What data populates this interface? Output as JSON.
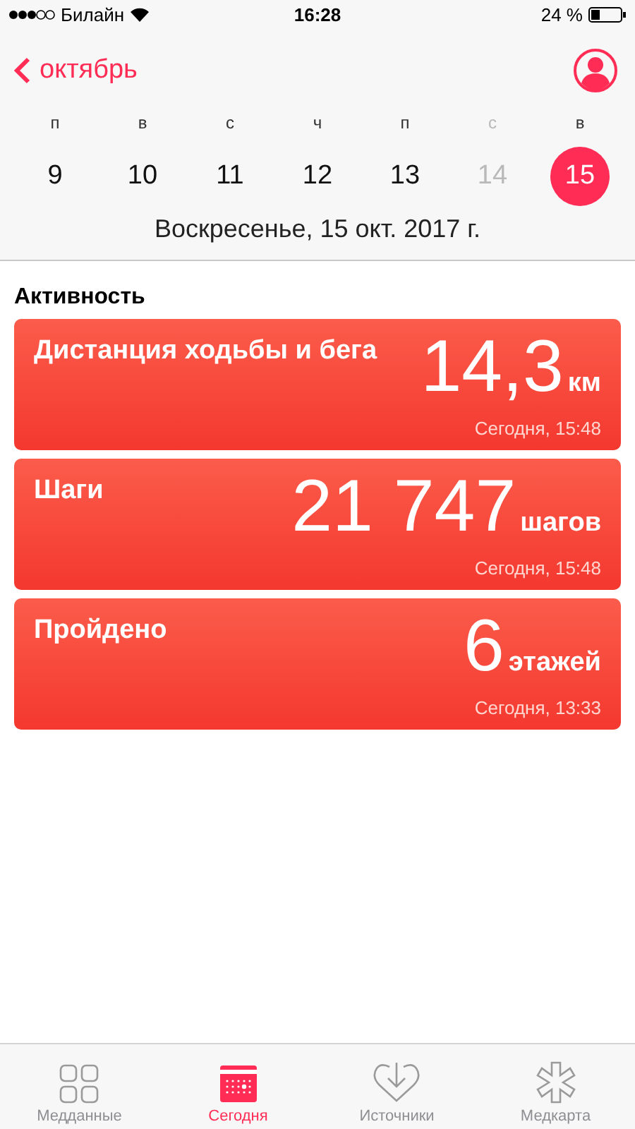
{
  "status_bar": {
    "carrier": "Билайн",
    "time": "16:28",
    "battery": "24 %"
  },
  "nav": {
    "back": "октябрь"
  },
  "week": [
    {
      "weekday": "п",
      "day": "9",
      "selected": false,
      "dimmed": false
    },
    {
      "weekday": "в",
      "day": "10",
      "selected": false,
      "dimmed": false
    },
    {
      "weekday": "с",
      "day": "11",
      "selected": false,
      "dimmed": false
    },
    {
      "weekday": "ч",
      "day": "12",
      "selected": false,
      "dimmed": false
    },
    {
      "weekday": "п",
      "day": "13",
      "selected": false,
      "dimmed": false
    },
    {
      "weekday": "с",
      "day": "14",
      "selected": false,
      "dimmed": true
    },
    {
      "weekday": "в",
      "day": "15",
      "selected": true,
      "dimmed": false
    }
  ],
  "date_title": "Воскресенье, 15 окт. 2017 г.",
  "section_title": "Активность",
  "cards": [
    {
      "title": "Дистанция ходьбы и бега",
      "value": "14,3",
      "unit": "км",
      "time": "Сегодня, 15:48"
    },
    {
      "title": "Шаги",
      "value": "21 747",
      "unit": "шагов",
      "time": "Сегодня, 15:48"
    },
    {
      "title": "Пройдено",
      "value": "6",
      "unit": "этажей",
      "time": "Сегодня, 13:33"
    }
  ],
  "tab_bar": [
    {
      "kind": "grid",
      "label": "Медданные",
      "selected": false
    },
    {
      "kind": "calendar",
      "label": "Сегодня",
      "selected": true
    },
    {
      "kind": "heart",
      "label": "Источники",
      "selected": false
    },
    {
      "kind": "asterisk",
      "label": "Медкарта",
      "selected": false
    }
  ]
}
